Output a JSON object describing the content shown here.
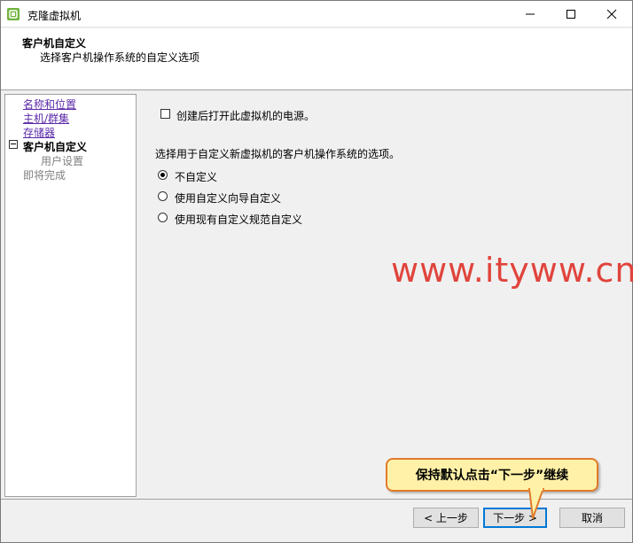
{
  "window": {
    "title": "克隆虚拟机",
    "buttons": {
      "minimize": "minimize",
      "maximize": "maximize",
      "close": "close"
    }
  },
  "header": {
    "title": "客户机自定义",
    "subtitle": "选择客户机操作系统的自定义选项"
  },
  "nav": {
    "items": [
      {
        "label": "名称和位置",
        "state": "link"
      },
      {
        "label": "主机/群集",
        "state": "link"
      },
      {
        "label": "存储器",
        "state": "link"
      },
      {
        "label": "客户机自定义",
        "state": "current"
      },
      {
        "label": "用户设置",
        "state": "disabled"
      },
      {
        "label": "即将完成",
        "state": "disabled"
      }
    ]
  },
  "content": {
    "power_on_checkbox": {
      "label": "创建后打开此虚拟机的电源。",
      "checked": false
    },
    "prompt": "选择用于自定义新虚拟机的客户机操作系统的选项。",
    "radios": [
      {
        "label": "不自定义",
        "checked": true
      },
      {
        "label": "使用自定义向导自定义",
        "checked": false
      },
      {
        "label": "使用现有自定义规范自定义",
        "checked": false
      }
    ]
  },
  "watermark": "www.ityww.cn",
  "footer": {
    "back_label": "< 上一步",
    "next_label": "下一步 >",
    "cancel_label": "取消"
  },
  "callout": {
    "text": "保持默认点击“下一步”继续"
  },
  "colors": {
    "link": "#5b2aa8",
    "watermark": "#e0443c",
    "callout_fill": "#fff2a8",
    "callout_border": "#e07b2b",
    "focus": "#0078d7"
  }
}
